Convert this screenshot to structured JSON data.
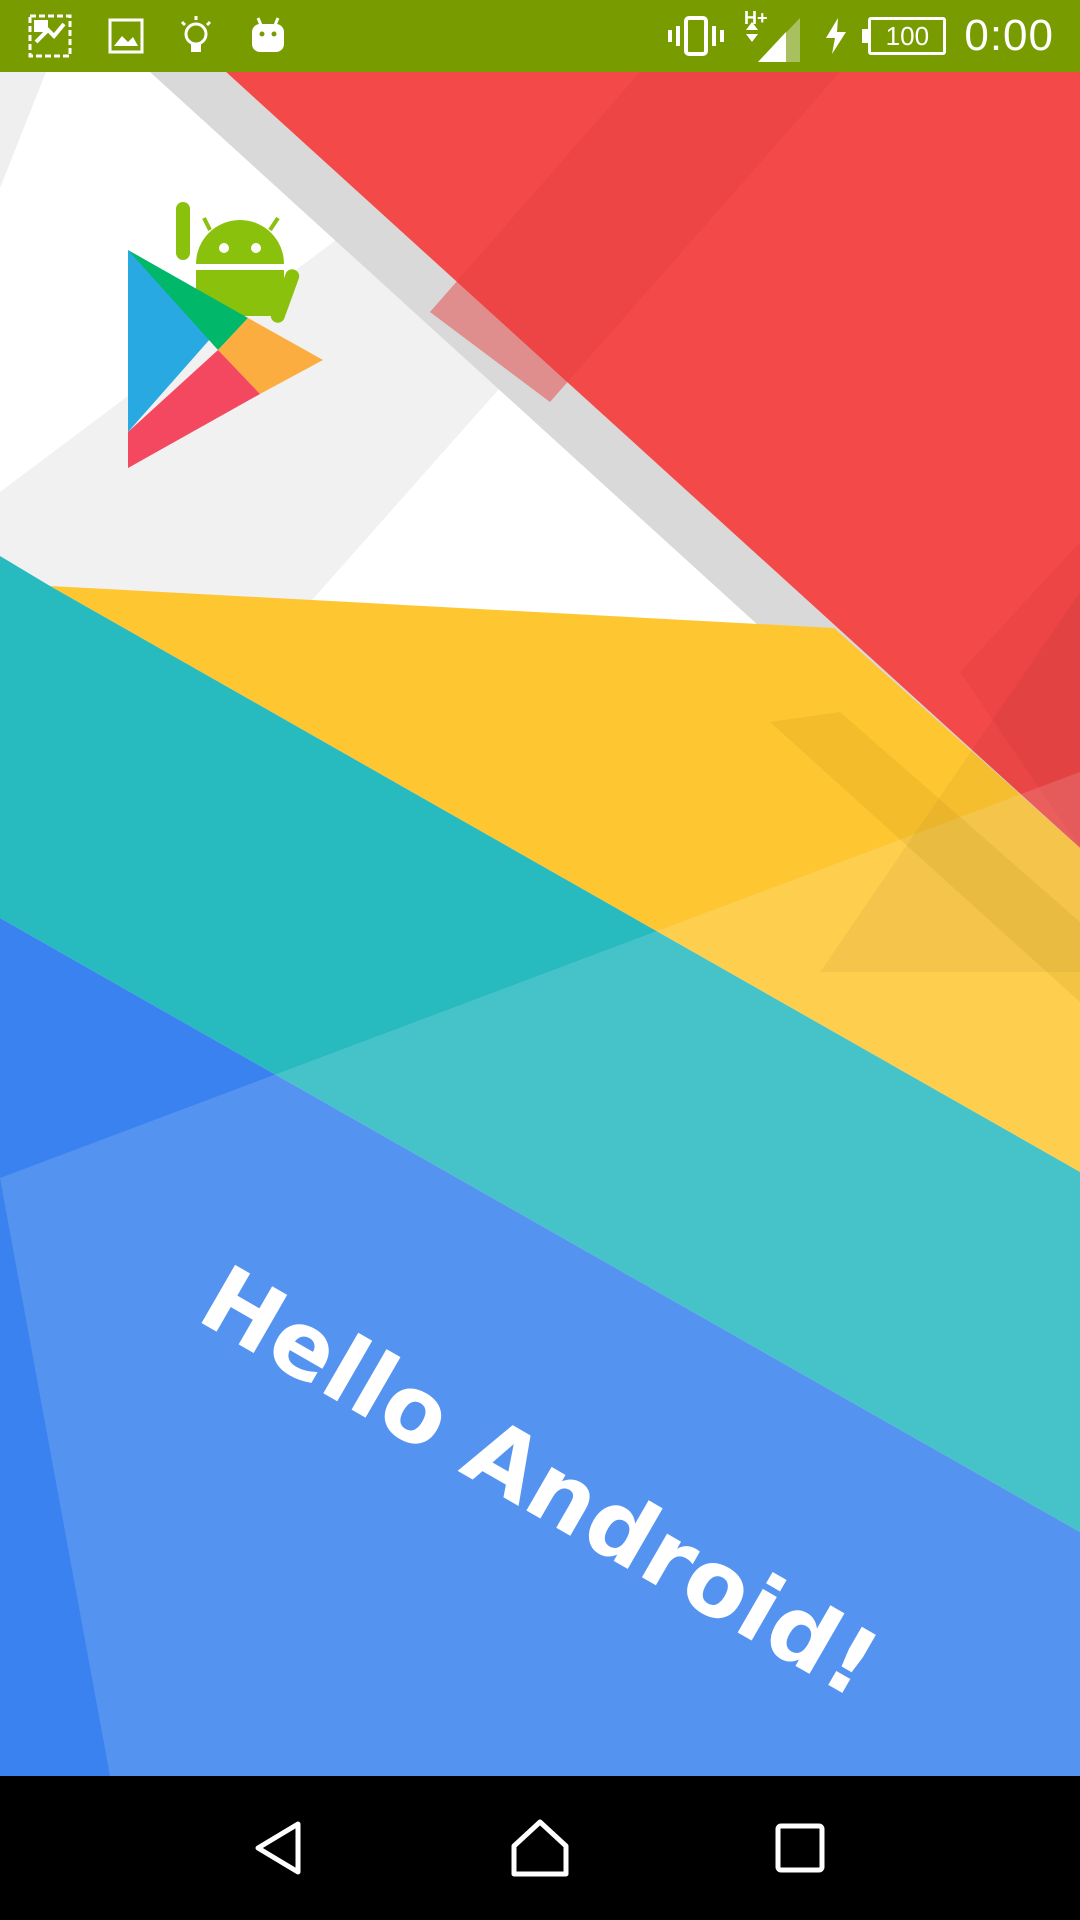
{
  "status_bar": {
    "background_color": "#789c00",
    "left_icons": [
      "screenshot-icon",
      "image-icon",
      "lightbulb-icon",
      "android-head-icon"
    ],
    "right_icons": [
      "vibrate-icon",
      "signal-icon",
      "charging-icon"
    ],
    "network_type": "H+",
    "battery_level": "100",
    "time": "0:00"
  },
  "content": {
    "greeting": "Hello Android!",
    "logo": "play-store-android-icon",
    "colors": {
      "red": "#f44949",
      "yellow": "#fec631",
      "teal": "#27babf",
      "blue": "#5587ea",
      "white": "#ffffff"
    }
  },
  "nav_bar": {
    "buttons": [
      "back",
      "home",
      "recents"
    ]
  }
}
